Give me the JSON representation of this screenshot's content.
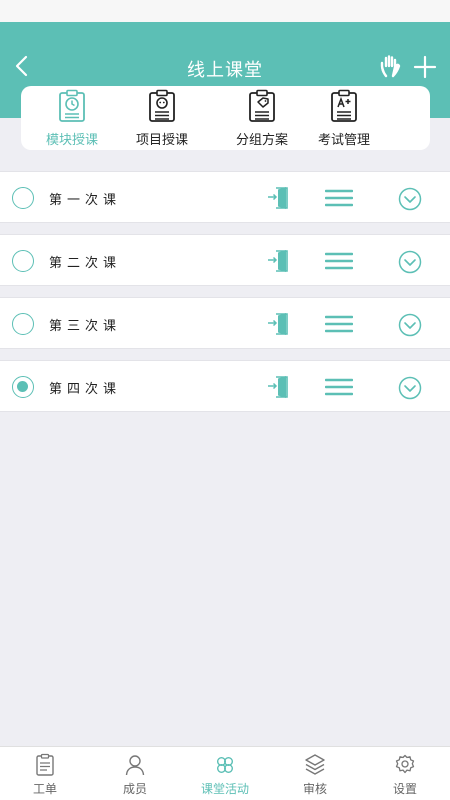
{
  "header": {
    "title": "线上课堂",
    "back_icon": "chevron-left-icon",
    "raise_hand_icon": "hand-icon",
    "add_icon": "plus-icon"
  },
  "tabs": [
    {
      "label": "模块授课",
      "icon": "clipboard-clock-icon",
      "active": true
    },
    {
      "label": "项目授课",
      "icon": "clipboard-face-icon",
      "active": false
    },
    {
      "label": "分组方案",
      "icon": "clipboard-tag-icon",
      "active": false
    },
    {
      "label": "考试管理",
      "icon": "clipboard-grade-icon",
      "active": false
    }
  ],
  "lessons": [
    {
      "label": "第一次课",
      "selected": false
    },
    {
      "label": "第二次课",
      "selected": false
    },
    {
      "label": "第三次课",
      "selected": false
    },
    {
      "label": "第四次课",
      "selected": true
    }
  ],
  "bottom_nav": [
    {
      "label": "工单",
      "icon": "clipboard-icon",
      "active": false
    },
    {
      "label": "成员",
      "icon": "person-icon",
      "active": false
    },
    {
      "label": "课堂活动",
      "icon": "four-petal-icon",
      "active": true
    },
    {
      "label": "审核",
      "icon": "layers-icon",
      "active": false
    },
    {
      "label": "设置",
      "icon": "gear-icon",
      "active": false
    }
  ],
  "colors": {
    "accent": "#5cbfb5",
    "background": "#eeeef3"
  }
}
